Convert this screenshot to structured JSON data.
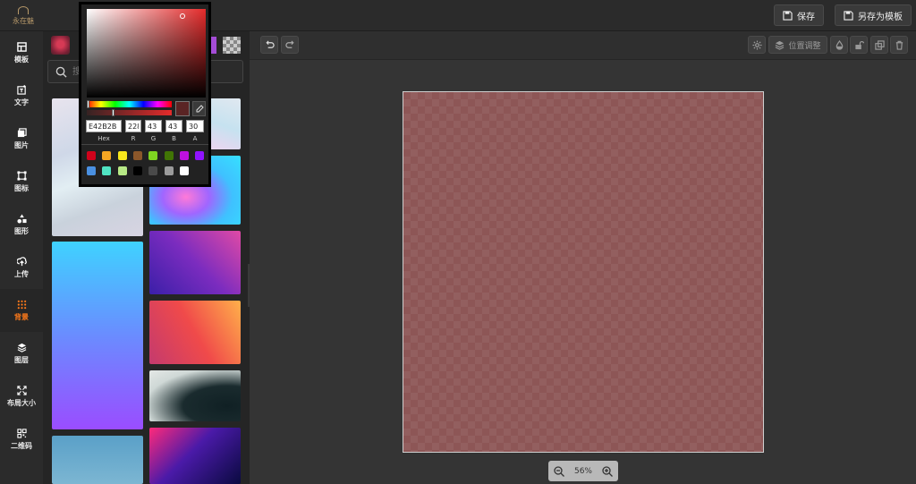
{
  "header": {
    "logo_text": "永在魅",
    "save_label": "保存",
    "save_template_label": "另存为模板"
  },
  "nav": [
    {
      "label": "模板",
      "icon": "template-icon"
    },
    {
      "label": "文字",
      "icon": "text-icon"
    },
    {
      "label": "图片",
      "icon": "image-icon"
    },
    {
      "label": "图标",
      "icon": "icon-icon"
    },
    {
      "label": "图形",
      "icon": "shapes-icon"
    },
    {
      "label": "上传",
      "icon": "upload-icon"
    },
    {
      "label": "背景",
      "icon": "background-icon",
      "active": true
    },
    {
      "label": "图层",
      "icon": "layers-icon"
    },
    {
      "label": "布局大小",
      "icon": "resize-icon"
    },
    {
      "label": "二维码",
      "icon": "qrcode-icon"
    }
  ],
  "search": {
    "placeholder": "搜",
    "value": ""
  },
  "toolbar": {
    "position_label": "位置调整"
  },
  "zoom": {
    "value": "56%"
  },
  "color_picker": {
    "hex": "E42B2B",
    "r": "228",
    "g": "43",
    "b": "43",
    "a": "30",
    "labels": {
      "hex": "Hex",
      "r": "R",
      "g": "G",
      "b": "B",
      "a": "A"
    },
    "presets": [
      "#d0021b",
      "#f5a623",
      "#f8e71c",
      "#8b572a",
      "#7ed321",
      "#417505",
      "#bd10e0",
      "#9013fe",
      "#4a90e2",
      "#50e3c2",
      "#b8e986",
      "#000000",
      "#4a4a4a",
      "#9b9b9b",
      "#ffffff"
    ]
  },
  "colors": {
    "accent": "#ff7a1a",
    "canvas_fill": "#8d5656",
    "selected_color": "#e42b2b"
  }
}
